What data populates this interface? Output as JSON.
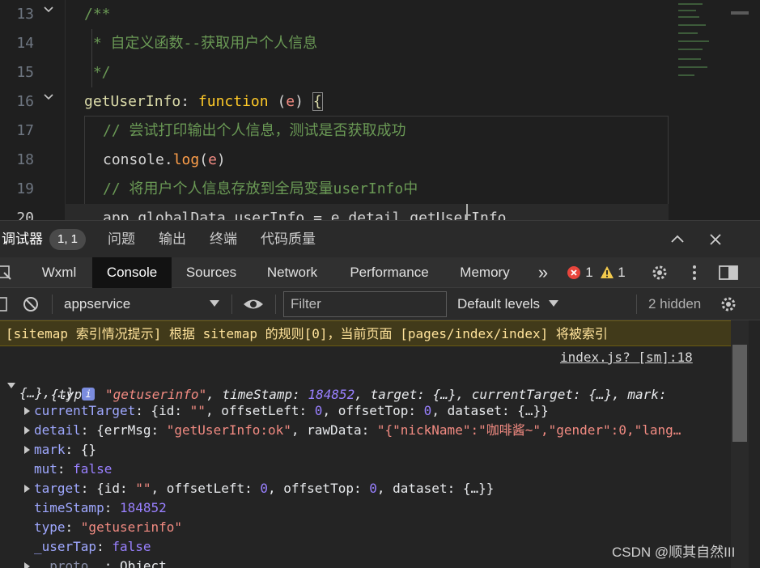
{
  "editor": {
    "line_numbers": [
      "13",
      "14",
      "15",
      "16",
      "17",
      "18",
      "19",
      "20"
    ],
    "lines": {
      "l13": "/**",
      "l14": " * 自定义函数--获取用户个人信息",
      "l15": " */",
      "l16_name": "getUserInfo",
      "l16_colon": ": ",
      "l16_kw": "function",
      "l16_open": " (",
      "l16_param": "e",
      "l16_close": ") ",
      "l16_brace": "{",
      "l17": "// 尝试打印输出个人信息，测试是否获取成功",
      "l18_obj": "console.",
      "l18_method": "log",
      "l18_open": "(",
      "l18_param": "e",
      "l18_close": ")",
      "l19": "// 将用户个人信息存放到全局变量userInfo中",
      "l20": "app.globalData.userInfo = e.detail.getUserInfo"
    }
  },
  "panel_tabs": {
    "debugger": "调试器",
    "debugger_badge": "1, 1",
    "problems": "问题",
    "output": "输出",
    "terminal": "终端",
    "code_quality": "代码质量",
    "collapse_icon": "chevron-up-icon",
    "close_icon": "close-icon"
  },
  "devtools_tabs": {
    "wxml": "Wxml",
    "console": "Console",
    "sources": "Sources",
    "network": "Network",
    "performance": "Performance",
    "memory": "Memory",
    "more": "»",
    "error_count": "1",
    "warning_count": "1"
  },
  "toolbar": {
    "context": "appservice",
    "filter_placeholder": "Filter",
    "levels": "Default levels",
    "hidden": "2 hidden"
  },
  "console": {
    "warning": "[sitemap 索引情况提示] 根据 sitemap 的规则[0]，当前页面 [pages/index/index] 将被索引",
    "source_link": "index.js? [sm]:18",
    "summary_line1": {
      "open": "{",
      "k_type": "type",
      "v_type": "\"getuserinfo\"",
      "k_ts": "timeStamp",
      "v_ts": "184852",
      "k_target": "target",
      "v_target": "{…}",
      "k_ct": "currentTarget",
      "v_ct": "{…}",
      "k_mark": "mark"
    },
    "summary_line2": "{…}, …}",
    "info_badge": "i",
    "props": {
      "currentTarget": {
        "key": "currentTarget",
        "val_pre": "{id: ",
        "id": "\"\"",
        "ol_key": ", offsetLeft: ",
        "ol": "0",
        "ot_key": ", offsetTop: ",
        "ot": "0",
        "ds": ", dataset: {…}}"
      },
      "detail": {
        "key": "detail",
        "val_pre": "{errMsg: ",
        "errmsg": "\"getUserInfo:ok\"",
        "raw_key": ", rawData: ",
        "raw": "\"{\"nickName\":\"咖啡酱~\",\"gender\":0,\"lang…"
      },
      "mark": {
        "key": "mark",
        "val": "{}"
      },
      "mut": {
        "key": "mut",
        "val": "false"
      },
      "target": {
        "key": "target",
        "val_pre": "{id: ",
        "id": "\"\"",
        "ol_key": ", offsetLeft: ",
        "ol": "0",
        "ot_key": ", offsetTop: ",
        "ot": "0",
        "ds": ", dataset: {…}}"
      },
      "timeStamp": {
        "key": "timeStamp",
        "val": "184852"
      },
      "type": {
        "key": "type",
        "val": "\"getuserinfo\""
      },
      "userTap": {
        "key": "_userTap",
        "val": "false"
      },
      "proto": {
        "key": "__proto__",
        "val": "Object"
      }
    }
  },
  "watermark": "CSDN @顺其自然III",
  "colors": {
    "accent_error": "#e8453c",
    "accent_warning": "#f2c94c",
    "warning_bg": "#413a1a"
  }
}
